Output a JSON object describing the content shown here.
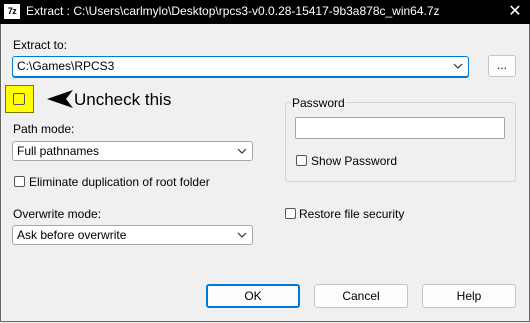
{
  "window": {
    "title": "Extract : C:\\Users\\carlmylo\\Desktop\\rpcs3-v0.0.28-15417-9b3a878c_win64.7z",
    "app_icon_text": "7z",
    "close_glyph": "✕"
  },
  "extract_to": {
    "label": "Extract to:",
    "value": "C:\\Games\\RPCS3",
    "browse_label": "..."
  },
  "annotation": {
    "text": "Uncheck this"
  },
  "path_mode": {
    "label": "Path mode:",
    "selected": "Full pathnames"
  },
  "eliminate_duplication": {
    "label": "Eliminate duplication of root folder",
    "checked": false
  },
  "overwrite_mode": {
    "label": "Overwrite mode:",
    "selected": "Ask before overwrite"
  },
  "password": {
    "group_label": "Password",
    "value": "",
    "show_label": "Show Password",
    "show_checked": false
  },
  "restore_security": {
    "label": "Restore file security",
    "checked": false
  },
  "buttons": {
    "ok": "OK",
    "cancel": "Cancel",
    "help": "Help"
  },
  "colors": {
    "accent": "#0078d4",
    "highlight": "#ffff00",
    "titlebar": "#000000"
  }
}
